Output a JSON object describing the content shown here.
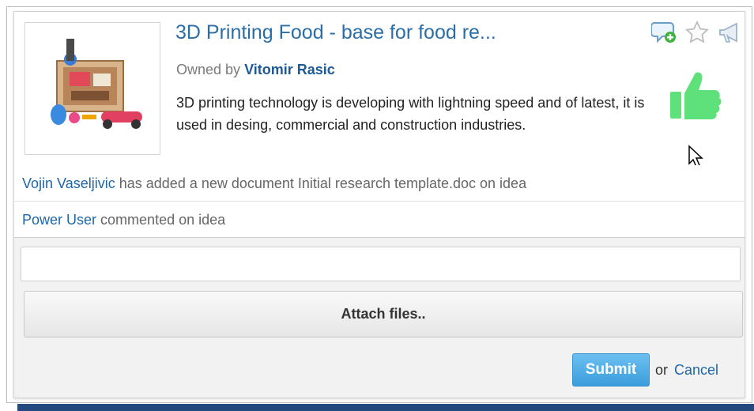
{
  "idea": {
    "title": "3D Printing Food - base for food re...",
    "owned_by_label": "Owned by",
    "owner_name": "Vitomir Rasic",
    "description": "3D printing technology is developing with lightning speed and of latest, it is used in desing, commercial and construction industries.",
    "image_alt": "3D printer with printed objects",
    "actions": {
      "comment_icon": "comment-add-icon",
      "star_icon": "star-icon",
      "share_icon": "megaphone-icon",
      "like_icon": "thumbs-up-icon",
      "like_color": "#5ee07a"
    }
  },
  "activity": [
    {
      "actor": "Vojin Vaseljivic",
      "text": "has added a new document Initial research template.doc on idea"
    },
    {
      "actor": "Power User",
      "text": "commented on idea"
    }
  ],
  "comment_form": {
    "input_value": "",
    "attach_label": "Attach files..",
    "submit_label": "Submit",
    "or_label": "or",
    "cancel_label": "Cancel"
  },
  "colors": {
    "link": "#1f66a6",
    "submit": "#3a9ddc",
    "footer_bar": "#23497e"
  }
}
